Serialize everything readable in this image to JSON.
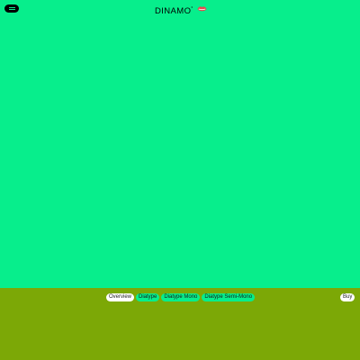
{
  "header": {
    "logo_text": "DINAMO",
    "logo_mark": "°",
    "logo_icon": "lips-icon",
    "menu_icon": "menu-icon"
  },
  "footer_nav": {
    "tabs": [
      {
        "label": "Overview",
        "active": true
      },
      {
        "label": "Diatype",
        "active": false
      },
      {
        "label": "Diatype Mono",
        "active": false
      },
      {
        "label": "Diatype Semi-Mono",
        "active": false
      }
    ],
    "buy_label": "Buy"
  },
  "colors": {
    "background": "#07EE8C",
    "footer_background": "#7CA806",
    "pill_background": "#07EE8C",
    "active_pill": "#FFFFFF"
  }
}
